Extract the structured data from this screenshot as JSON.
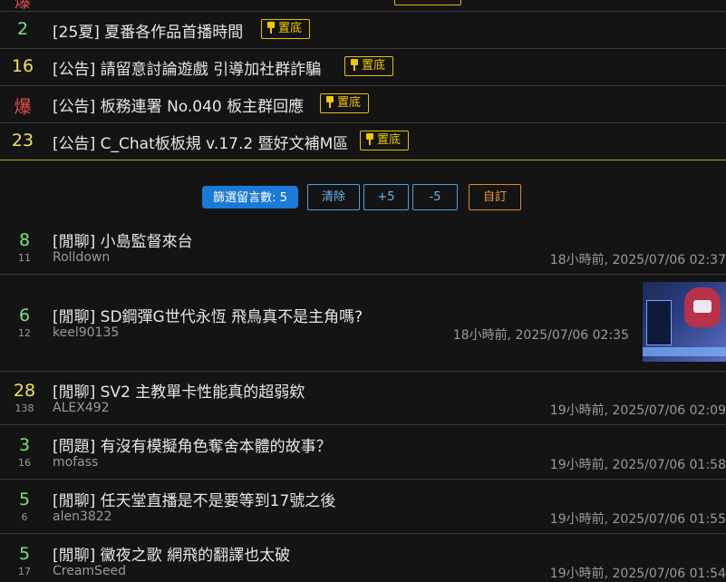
{
  "top_partial": {
    "count": "爆",
    "count_color": "#e84c4c"
  },
  "pinned": [
    {
      "count": "2",
      "count_color": "#7ce37c",
      "title": "[25夏] 夏番各作品首播時間",
      "pin_label": "置底"
    },
    {
      "count": "16",
      "count_color": "#f0e05a",
      "title": "[公告] 請留意討論遊戲 引導加社群詐騙",
      "pin_label": "置底"
    },
    {
      "count": "爆",
      "count_color": "#e84c4c",
      "title": "[公告] 板務連署 No.040 板主群回應",
      "pin_label": "置底"
    },
    {
      "count": "23",
      "count_color": "#f0e05a",
      "title": "[公告] C_Chat板板規 v.17.2 暨好文補M區",
      "pin_label": "置底"
    }
  ],
  "filter": {
    "filter_count_label": "篩選留言數: 5",
    "clear_label": "清除",
    "plus_label": "+5",
    "minus_label": "-5",
    "custom_label": "自訂"
  },
  "posts": [
    {
      "count": "8",
      "count_color": "#7ce37c",
      "sub": "11",
      "title": "[閒聊] 小島監督來台",
      "author": "Rolldown",
      "time": "18小時前, 2025/07/06 02:37",
      "has_thumb": false
    },
    {
      "count": "6",
      "count_color": "#7ce37c",
      "sub": "12",
      "title": "[閒聊] SD鋼彈G世代永恆 飛鳥真不是主角嗎?",
      "author": "keel90135",
      "time": "18小時前, 2025/07/06 02:35",
      "has_thumb": true
    },
    {
      "count": "28",
      "count_color": "#f0e05a",
      "sub": "138",
      "title": "[閒聊] SV2 主教單卡性能真的超弱欸",
      "author": "ALEX492",
      "time": "19小時前, 2025/07/06 02:09",
      "has_thumb": false
    },
    {
      "count": "3",
      "count_color": "#7ce37c",
      "sub": "16",
      "title": "[問題] 有沒有模擬角色奪舍本體的故事？",
      "author": "mofass",
      "time": "19小時前, 2025/07/06 01:58",
      "has_thumb": false
    },
    {
      "count": "5",
      "count_color": "#7ce37c",
      "sub": "6",
      "title": "[閒聊] 任天堂直播是不是要等到17號之後",
      "author": "alen3822",
      "time": "19小時前, 2025/07/06 01:55",
      "has_thumb": false
    },
    {
      "count": "5",
      "count_color": "#7ce37c",
      "sub": "17",
      "title": "[閒聊] 黴夜之歌 網飛的翻譯也太破",
      "author": "CreamSeed",
      "time": "19小時前, 2025/07/06 01:54",
      "has_thumb": false
    }
  ]
}
